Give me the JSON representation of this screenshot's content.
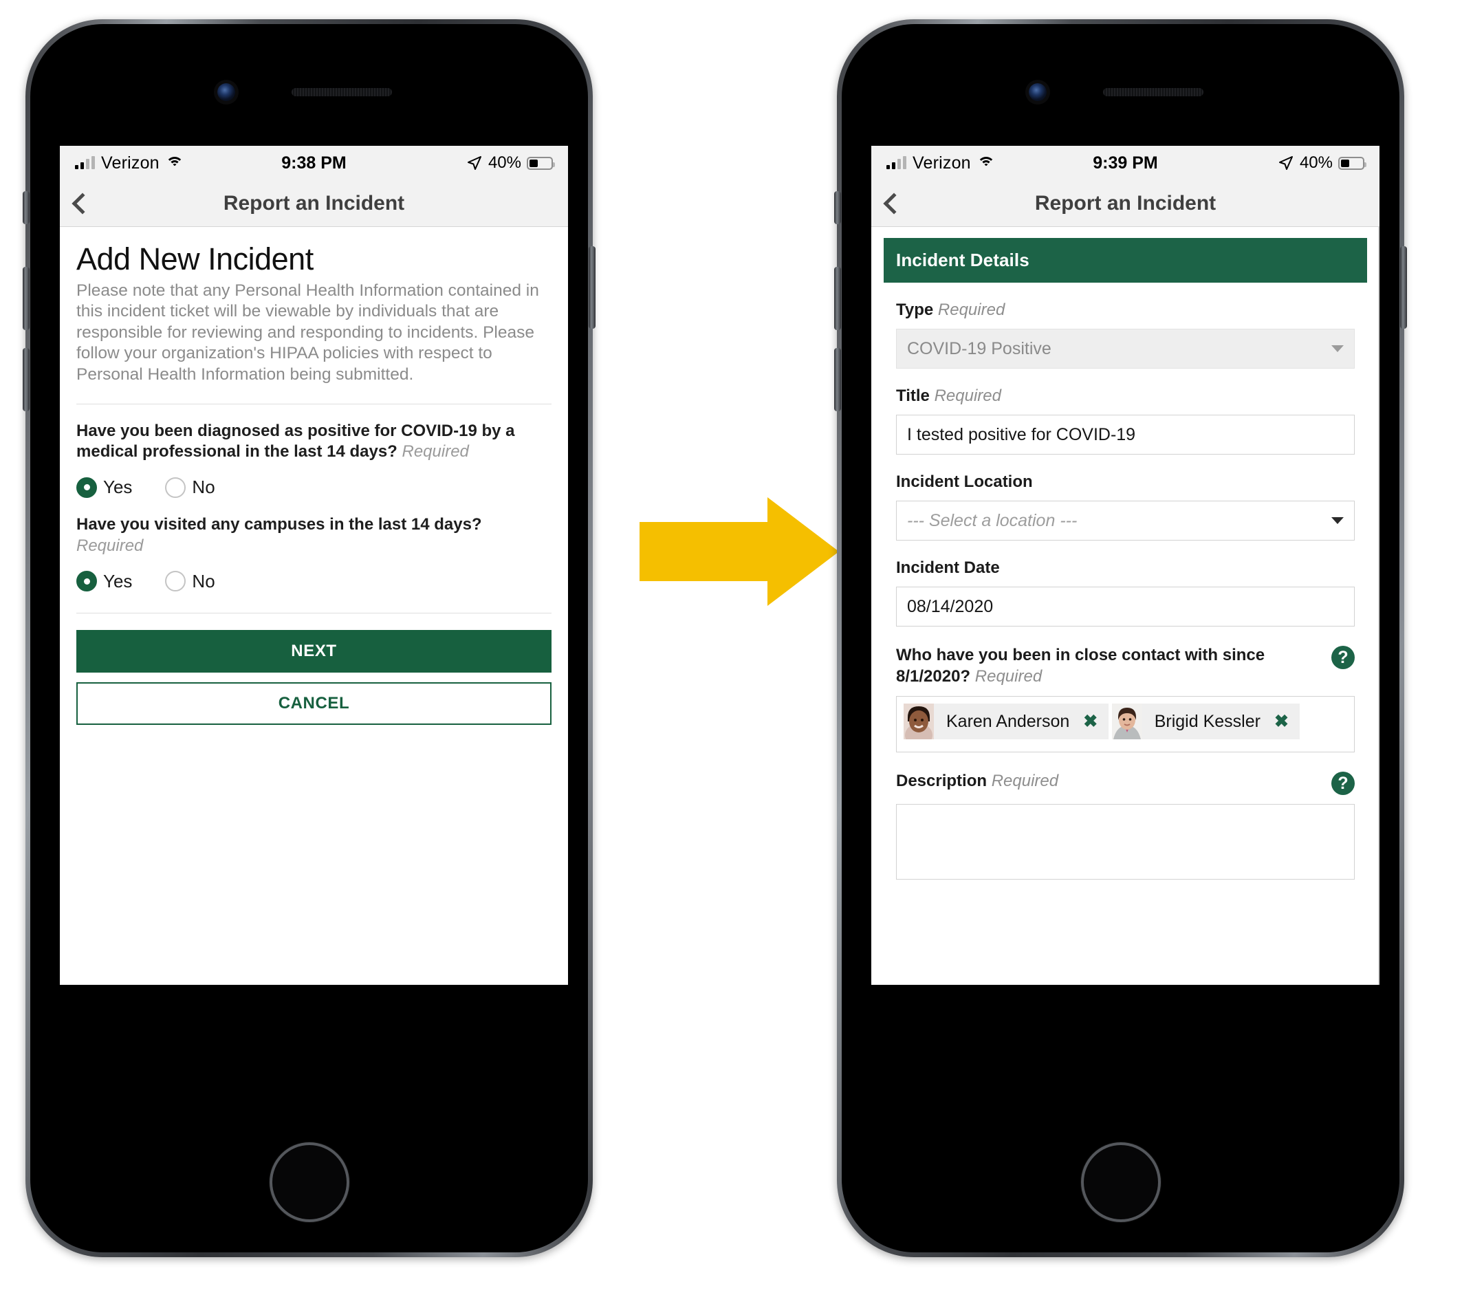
{
  "meta": {
    "accent_green": "#1c6347",
    "arrow_color": "#F5BF00",
    "arrow_name": "flow-arrow"
  },
  "phone_left": {
    "status_bar": {
      "carrier": "Verizon",
      "time": "9:38 PM",
      "battery_percent": "40%",
      "signal_icon": "cellular-signal-icon",
      "wifi_icon": "wifi-icon",
      "location_icon": "location-arrow-icon",
      "battery_icon": "battery-icon"
    },
    "nav": {
      "back_icon": "back-chevron-icon",
      "title": "Report an Incident"
    },
    "screen": {
      "heading": "Add New Incident",
      "intro": "Please note that any Personal Health Information contained in this incident ticket will be viewable by individuals that are responsible for reviewing and responding to incidents. Please follow your organization's HIPAA policies with respect to Personal Health Information being submitted.",
      "questions": [
        {
          "text": "Have you been diagnosed as positive for COVID-19 by a medical professional in the last 14 days?",
          "required_label": "Required",
          "options": [
            {
              "label": "Yes",
              "selected": true
            },
            {
              "label": "No",
              "selected": false
            }
          ]
        },
        {
          "text": "Have you visited any campuses in the last 14 days?",
          "required_label": "Required",
          "options": [
            {
              "label": "Yes",
              "selected": true
            },
            {
              "label": "No",
              "selected": false
            }
          ]
        }
      ],
      "next_button": "NEXT",
      "cancel_button": "CANCEL"
    }
  },
  "phone_right": {
    "status_bar": {
      "carrier": "Verizon",
      "time": "9:39 PM",
      "battery_percent": "40%",
      "signal_icon": "cellular-signal-icon",
      "wifi_icon": "wifi-icon",
      "location_icon": "location-arrow-icon",
      "battery_icon": "battery-icon"
    },
    "nav": {
      "back_icon": "back-chevron-icon",
      "title": "Report an Incident"
    },
    "screen": {
      "panel_title": "Incident Details",
      "type": {
        "label": "Type",
        "required_label": "Required",
        "value": "COVID-19 Positive",
        "disabled": true,
        "caret_icon": "chevron-down-icon"
      },
      "title_field": {
        "label": "Title",
        "required_label": "Required",
        "value": "I tested positive for COVID-19"
      },
      "location": {
        "label": "Incident Location",
        "placeholder": "--- Select a location ---",
        "value": "",
        "caret_icon": "chevron-down-icon"
      },
      "date": {
        "label": "Incident Date",
        "value": "08/14/2020"
      },
      "close_contact": {
        "label": "Who have you been in close contact with since 8/1/2020?",
        "required_label": "Required",
        "help_icon": "question-mark-help-icon",
        "help_glyph": "?",
        "contacts": [
          {
            "name": "Karen Anderson",
            "remove_glyph": "✖",
            "avatar_icon": "avatar-karen-anderson"
          },
          {
            "name": "Brigid Kessler",
            "remove_glyph": "✖",
            "avatar_icon": "avatar-brigid-kessler"
          }
        ]
      },
      "description": {
        "label": "Description",
        "required_label": "Required",
        "help_icon": "question-mark-help-icon",
        "help_glyph": "?",
        "value": ""
      }
    }
  }
}
